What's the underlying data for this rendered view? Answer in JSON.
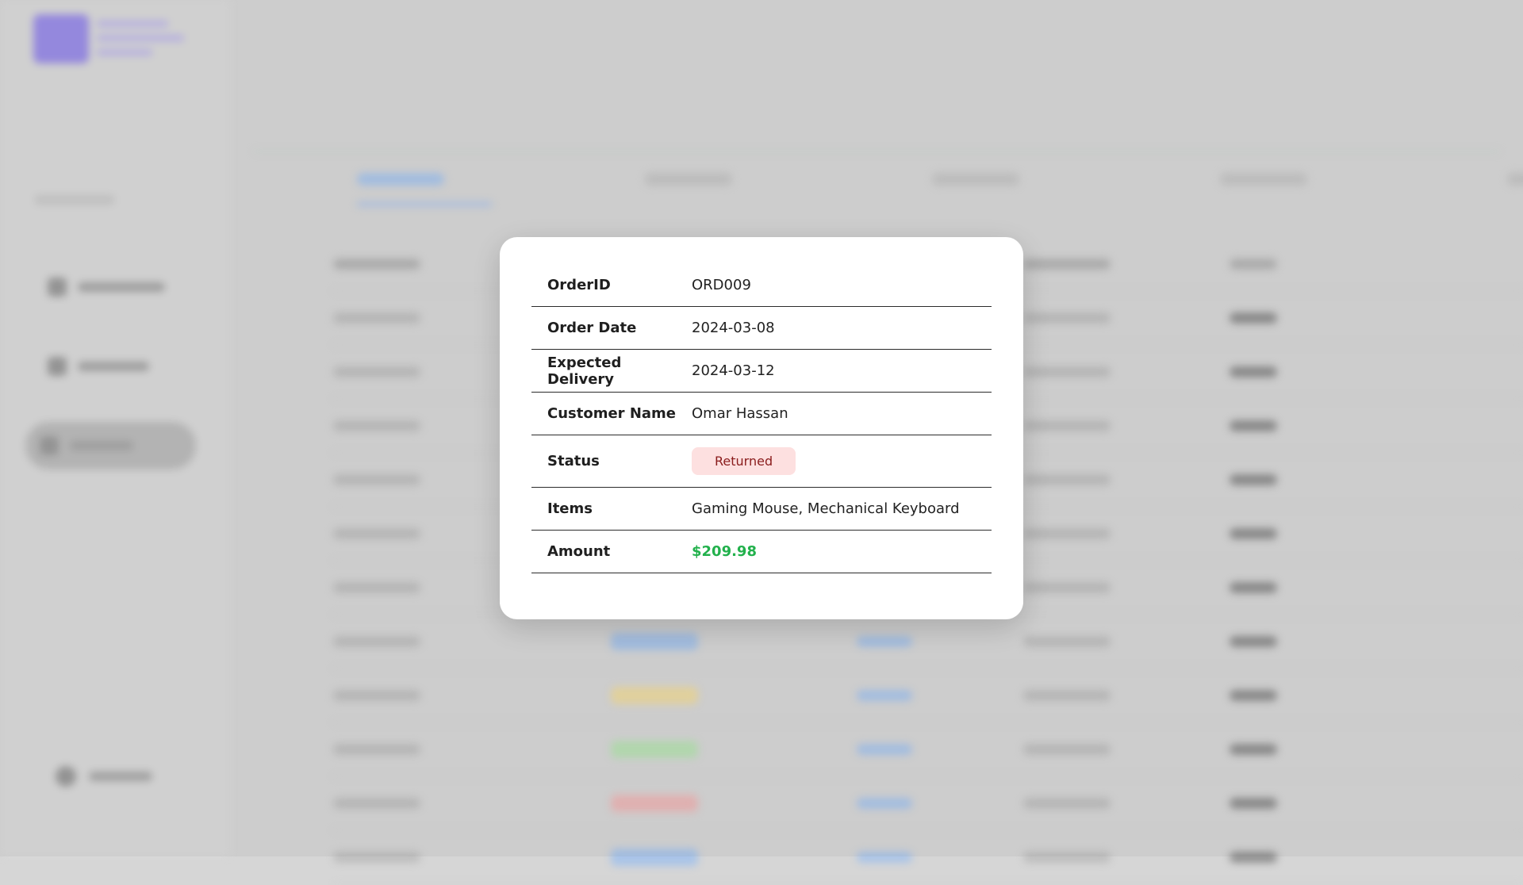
{
  "order": {
    "rows": [
      {
        "label": "OrderID",
        "value": "ORD009"
      },
      {
        "label": "Order Date",
        "value": "2024-03-08"
      },
      {
        "label": "Expected Delivery",
        "value": "2024-03-12"
      },
      {
        "label": "Customer Name",
        "value": "Omar Hassan"
      },
      {
        "label": "Status",
        "value": "Returned"
      },
      {
        "label": "Items",
        "value": "Gaming Mouse, Mechanical Keyboard"
      },
      {
        "label": "Amount",
        "value": "$209.98"
      }
    ]
  },
  "colors": {
    "status_returned_bg": "#fde0e0",
    "status_returned_text": "#8a1c1c",
    "amount": "#22b14c",
    "accent": "#9b8ee6"
  }
}
